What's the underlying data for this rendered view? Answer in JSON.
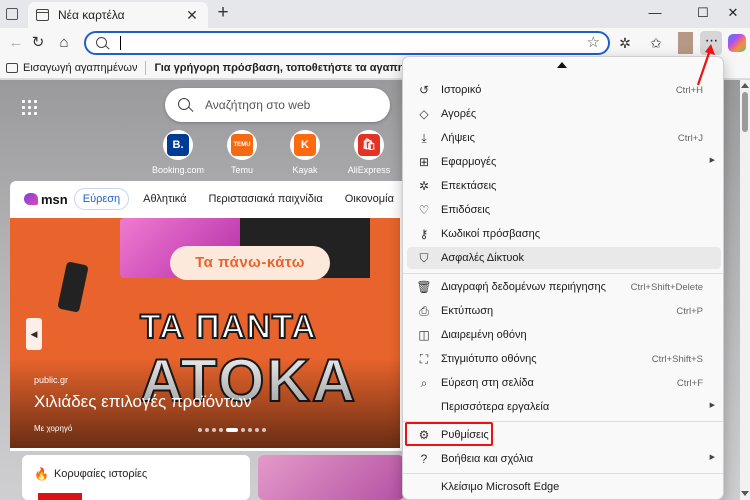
{
  "tab": {
    "title": "Νέα καρτέλα",
    "close": "✕",
    "new": "+"
  },
  "window": {
    "minimize": "—",
    "maximize": "☐",
    "close": "✕"
  },
  "address": {
    "value": "",
    "placeholder": ""
  },
  "favorites_bar": {
    "import_label": "Εισαγωγή αγαπημένων",
    "hint": "Για γρήγορη πρόσβαση, τοποθετήστε τα αγαπημένα σας εδώ στ"
  },
  "search": {
    "placeholder": "Αναζήτηση στο web"
  },
  "quick_links": [
    {
      "label": "Booking.com",
      "glyph": "B.",
      "color": "#003b95"
    },
    {
      "label": "Temu",
      "glyph": "TEMU",
      "color": "#f46a12"
    },
    {
      "label": "Kayak",
      "glyph": "K",
      "color": "#ff690f"
    },
    {
      "label": "AliExpress",
      "glyph": "🛍",
      "color": "#e43225"
    }
  ],
  "msn": {
    "logo": "msn",
    "tabs": [
      "Εύρεση",
      "Αθλητικά",
      "Περιστασιακά παιχνίδια",
      "Οικονομία"
    ],
    "hero": {
      "promo": "Τα πάνω-κάτω",
      "big_line1": "ΤΑ ΠΑΝΤΑ",
      "big_line2": "ΑΤΟΚΑ",
      "source": "public.gr",
      "headline": "Χιλιάδες επιλογές προϊόντων",
      "sponsored": "Με χορηγό"
    },
    "stories_title": "Κορυφαίες ιστορίες"
  },
  "menu": {
    "items": [
      {
        "label": "Ιστορικό",
        "shortcut": "Ctrl+H",
        "icon": "history-icon",
        "glyph": "↺"
      },
      {
        "label": "Αγορές",
        "shortcut": "",
        "icon": "shopping-tag-icon",
        "glyph": "◇"
      },
      {
        "label": "Λήψεις",
        "shortcut": "Ctrl+J",
        "icon": "download-icon",
        "glyph": "⤓"
      },
      {
        "label": "Εφαρμογές",
        "shortcut": "",
        "icon": "apps-icon",
        "glyph": "⊞",
        "submenu": true
      },
      {
        "label": "Επεκτάσεις",
        "shortcut": "",
        "icon": "extensions-icon",
        "glyph": "✲"
      },
      {
        "label": "Επιδόσεις",
        "shortcut": "",
        "icon": "performance-icon",
        "glyph": "♡"
      },
      {
        "label": "Κωδικοί πρόσβασης",
        "shortcut": "",
        "icon": "key-icon",
        "glyph": "⚷"
      },
      {
        "label": "Ασφαλές Δίκτυοk",
        "shortcut": "",
        "icon": "shield-icon",
        "glyph": "⛉"
      },
      {
        "label": "Διαγραφή δεδομένων περιήγησης",
        "shortcut": "Ctrl+Shift+Delete",
        "icon": "trash-icon",
        "glyph": "🗑"
      },
      {
        "label": "Εκτύπωση",
        "shortcut": "Ctrl+P",
        "icon": "print-icon",
        "glyph": "⎙"
      },
      {
        "label": "Διαιρεμένη οθόνη",
        "shortcut": "",
        "icon": "split-screen-icon",
        "glyph": "◫"
      },
      {
        "label": "Στιγμιότυπο οθόνης",
        "shortcut": "Ctrl+Shift+S",
        "icon": "screenshot-icon",
        "glyph": "⛶"
      },
      {
        "label": "Εύρεση στη σελίδα",
        "shortcut": "Ctrl+F",
        "icon": "find-icon",
        "glyph": "⌕"
      },
      {
        "label": "Περισσότερα εργαλεία",
        "shortcut": "",
        "icon": "",
        "glyph": "",
        "submenu": true
      },
      {
        "label": "Ρυθμίσεις",
        "shortcut": "",
        "icon": "gear-icon",
        "glyph": "⚙"
      },
      {
        "label": "Βοήθεια και σχόλια",
        "shortcut": "",
        "icon": "help-icon",
        "glyph": "?",
        "submenu": true
      },
      {
        "label": "Κλείσιμο Microsoft Edge",
        "shortcut": "",
        "icon": "",
        "glyph": ""
      }
    ]
  },
  "annotation_color": "#e11111"
}
